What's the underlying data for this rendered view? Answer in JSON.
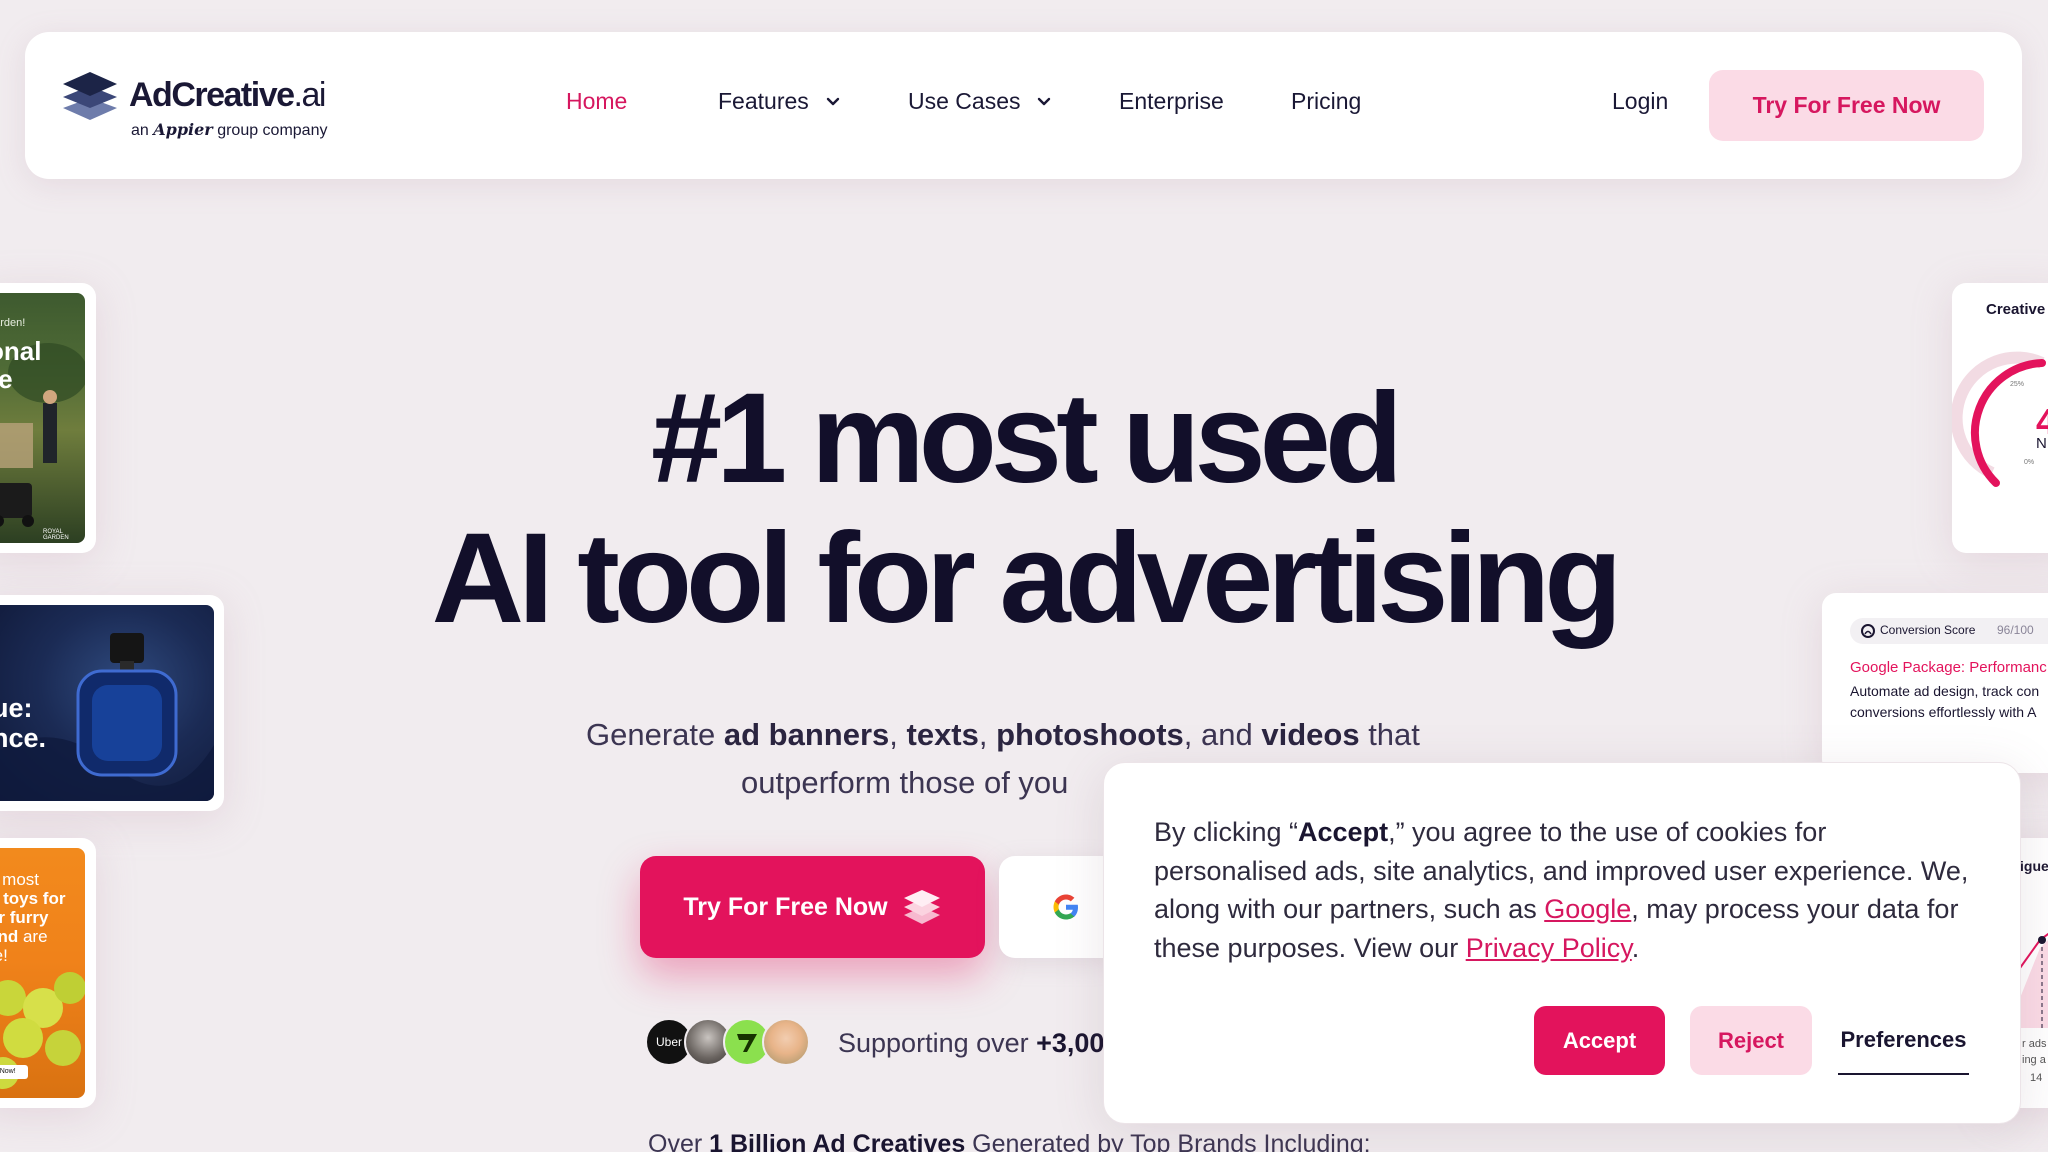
{
  "nav": {
    "logo_word": "AdCreative",
    "logo_suffix": ".ai",
    "logo_tag_prefix": "an",
    "logo_tag_brand": "Appier",
    "logo_tag_suffix": "group company",
    "links": [
      "Home",
      "Features",
      "Use Cases",
      "Enterprise",
      "Pricing"
    ],
    "login": "Login",
    "cta": "Try For Free Now"
  },
  "hero": {
    "line1": "#1 most used",
    "line2": "AI tool for advertising",
    "sub_part1": "Generate ",
    "sub_b1": "ad banners",
    "sub_sep1": ", ",
    "sub_b2": "texts",
    "sub_sep2": ", ",
    "sub_b3": "photoshoots",
    "sub_sep3": ", and ",
    "sub_b4": "videos",
    "sub_part2": " that",
    "sub_line2": "outperform those of you",
    "cta_primary": "Try For Free Now",
    "support_prefix": "Supporting over ",
    "support_value": "+3,00",
    "avatar_first": "Uber",
    "over_prefix": "Over ",
    "over_bold": "1 Billion Ad Creatives",
    "over_suffix": " Generated by Top Brands Including:"
  },
  "cards": {
    "left1_lines": [
      "garden!",
      "onal",
      "re"
    ],
    "left1_brand": "ROYAL GARDEN",
    "left2_lines": [
      "ue:",
      "nce."
    ],
    "left3_lines": [
      "e most",
      "n toys for",
      "ur furry",
      "end are",
      "re!"
    ],
    "left3_button": "op Now!",
    "right1_title": "Creative",
    "right1_pct_25": "25%",
    "right1_pct_0": "0%",
    "right1_num": "4",
    "right1_small": "N",
    "right2_score_label": "Conversion Score",
    "right2_score_value": "96/100",
    "right2_title": "Google Package: Performanc",
    "right2_line1": "Automate ad design, track con",
    "right2_line2": "conversions effortlessly with A",
    "right3_title": "igue",
    "right3_l1": "r ads",
    "right3_l2": "ing a",
    "right3_l3": "14"
  },
  "cookie": {
    "t1": "By clicking “",
    "t_accept": "Accept",
    "t2": ",” you agree to the use of cookies for personalised ads, site analytics, and improved user experience. We, along with our partners, such as ",
    "t_google": "Google",
    "t3": ", may process your data for these purposes. View our ",
    "t_policy": "Privacy Policy",
    "t4": ".",
    "accept": "Accept",
    "reject": "Reject",
    "preferences": "Preferences"
  },
  "colors": {
    "brand_pink": "#e3135c",
    "nav_active": "#d6175f",
    "soft_pink": "#fbdbe6",
    "background": "#f1ecef",
    "heading": "#120f2a"
  },
  "icons": [
    "logo-stack-icon",
    "chevron-down-icon",
    "cube-stack-icon",
    "google-g-icon"
  ]
}
